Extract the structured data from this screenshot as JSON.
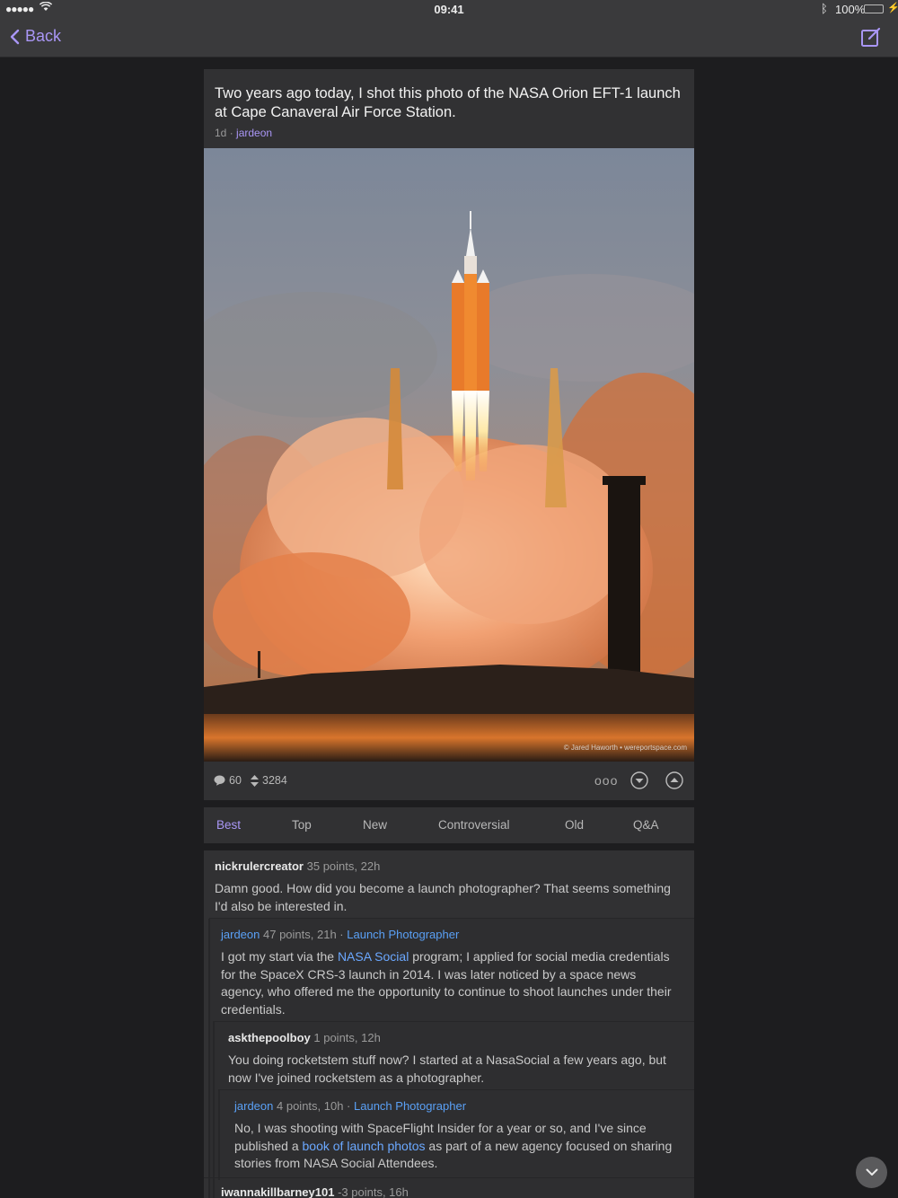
{
  "status_bar": {
    "time": "09:41",
    "battery": "100%",
    "signal": "●●●●●",
    "bluetooth_icon": "ᛒ"
  },
  "nav": {
    "back_label": "Back"
  },
  "post": {
    "title": "Two years ago today, I shot this photo of the NASA Orion EFT-1 launch at Cape Canaveral Air Force Station.",
    "age": "1d",
    "separator": "·",
    "author": "jardeon",
    "image_credit": "© Jared Haworth • wereportspace.com",
    "comments_count": "60",
    "score": "3284",
    "more_label": "ooo"
  },
  "sort_tabs": [
    "Best",
    "Top",
    "New",
    "Controversial",
    "Old",
    "Q&A"
  ],
  "comments": [
    {
      "user": "nickrulercreator",
      "meta": "35 points, 22h",
      "body": "Damn good. How did you become a launch photographer? That seems something I'd also be interested in."
    },
    {
      "user": "jardeon",
      "meta": "47 points, 21h ·",
      "flair": "Launch Photographer",
      "body_before": "I got my start via the ",
      "link": "NASA Social",
      "body_after": " program; I applied for social media credentials for the SpaceX CRS-3 launch in 2014.  I was later noticed by a space news agency, who offered me the opportunity to continue to shoot launches under their credentials."
    },
    {
      "user": "askthepoolboy",
      "meta": "1 points, 12h",
      "body": "You doing rocketstem stuff now? I started at a NasaSocial a few years ago, but now I've joined rocketstem as a photographer."
    },
    {
      "user": "jardeon",
      "meta": "4 points, 10h ·",
      "flair": "Launch Photographer",
      "body_before": "No, I was shooting with SpaceFlight Insider for a year or so, and I've since published a ",
      "link": "book of launch photos",
      "body_after": " as part of a new agency focused on sharing stories from NASA Social Attendees."
    },
    {
      "user": "iwannakillbarney101",
      "meta": "-3 points, 16h"
    }
  ]
}
